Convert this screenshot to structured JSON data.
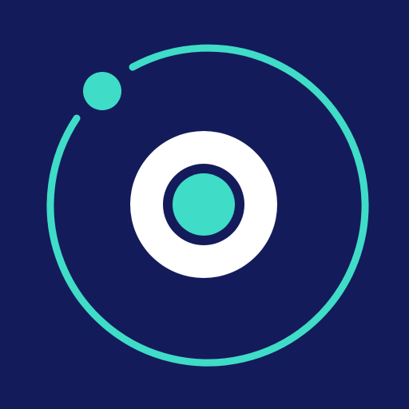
{
  "logo": {
    "icon": "orbit-logo-icon",
    "colors": {
      "background": "#141b5a",
      "accent": "#3fdcc8",
      "core_ring": "#ffffff",
      "core_gap": "#141b5a"
    }
  }
}
